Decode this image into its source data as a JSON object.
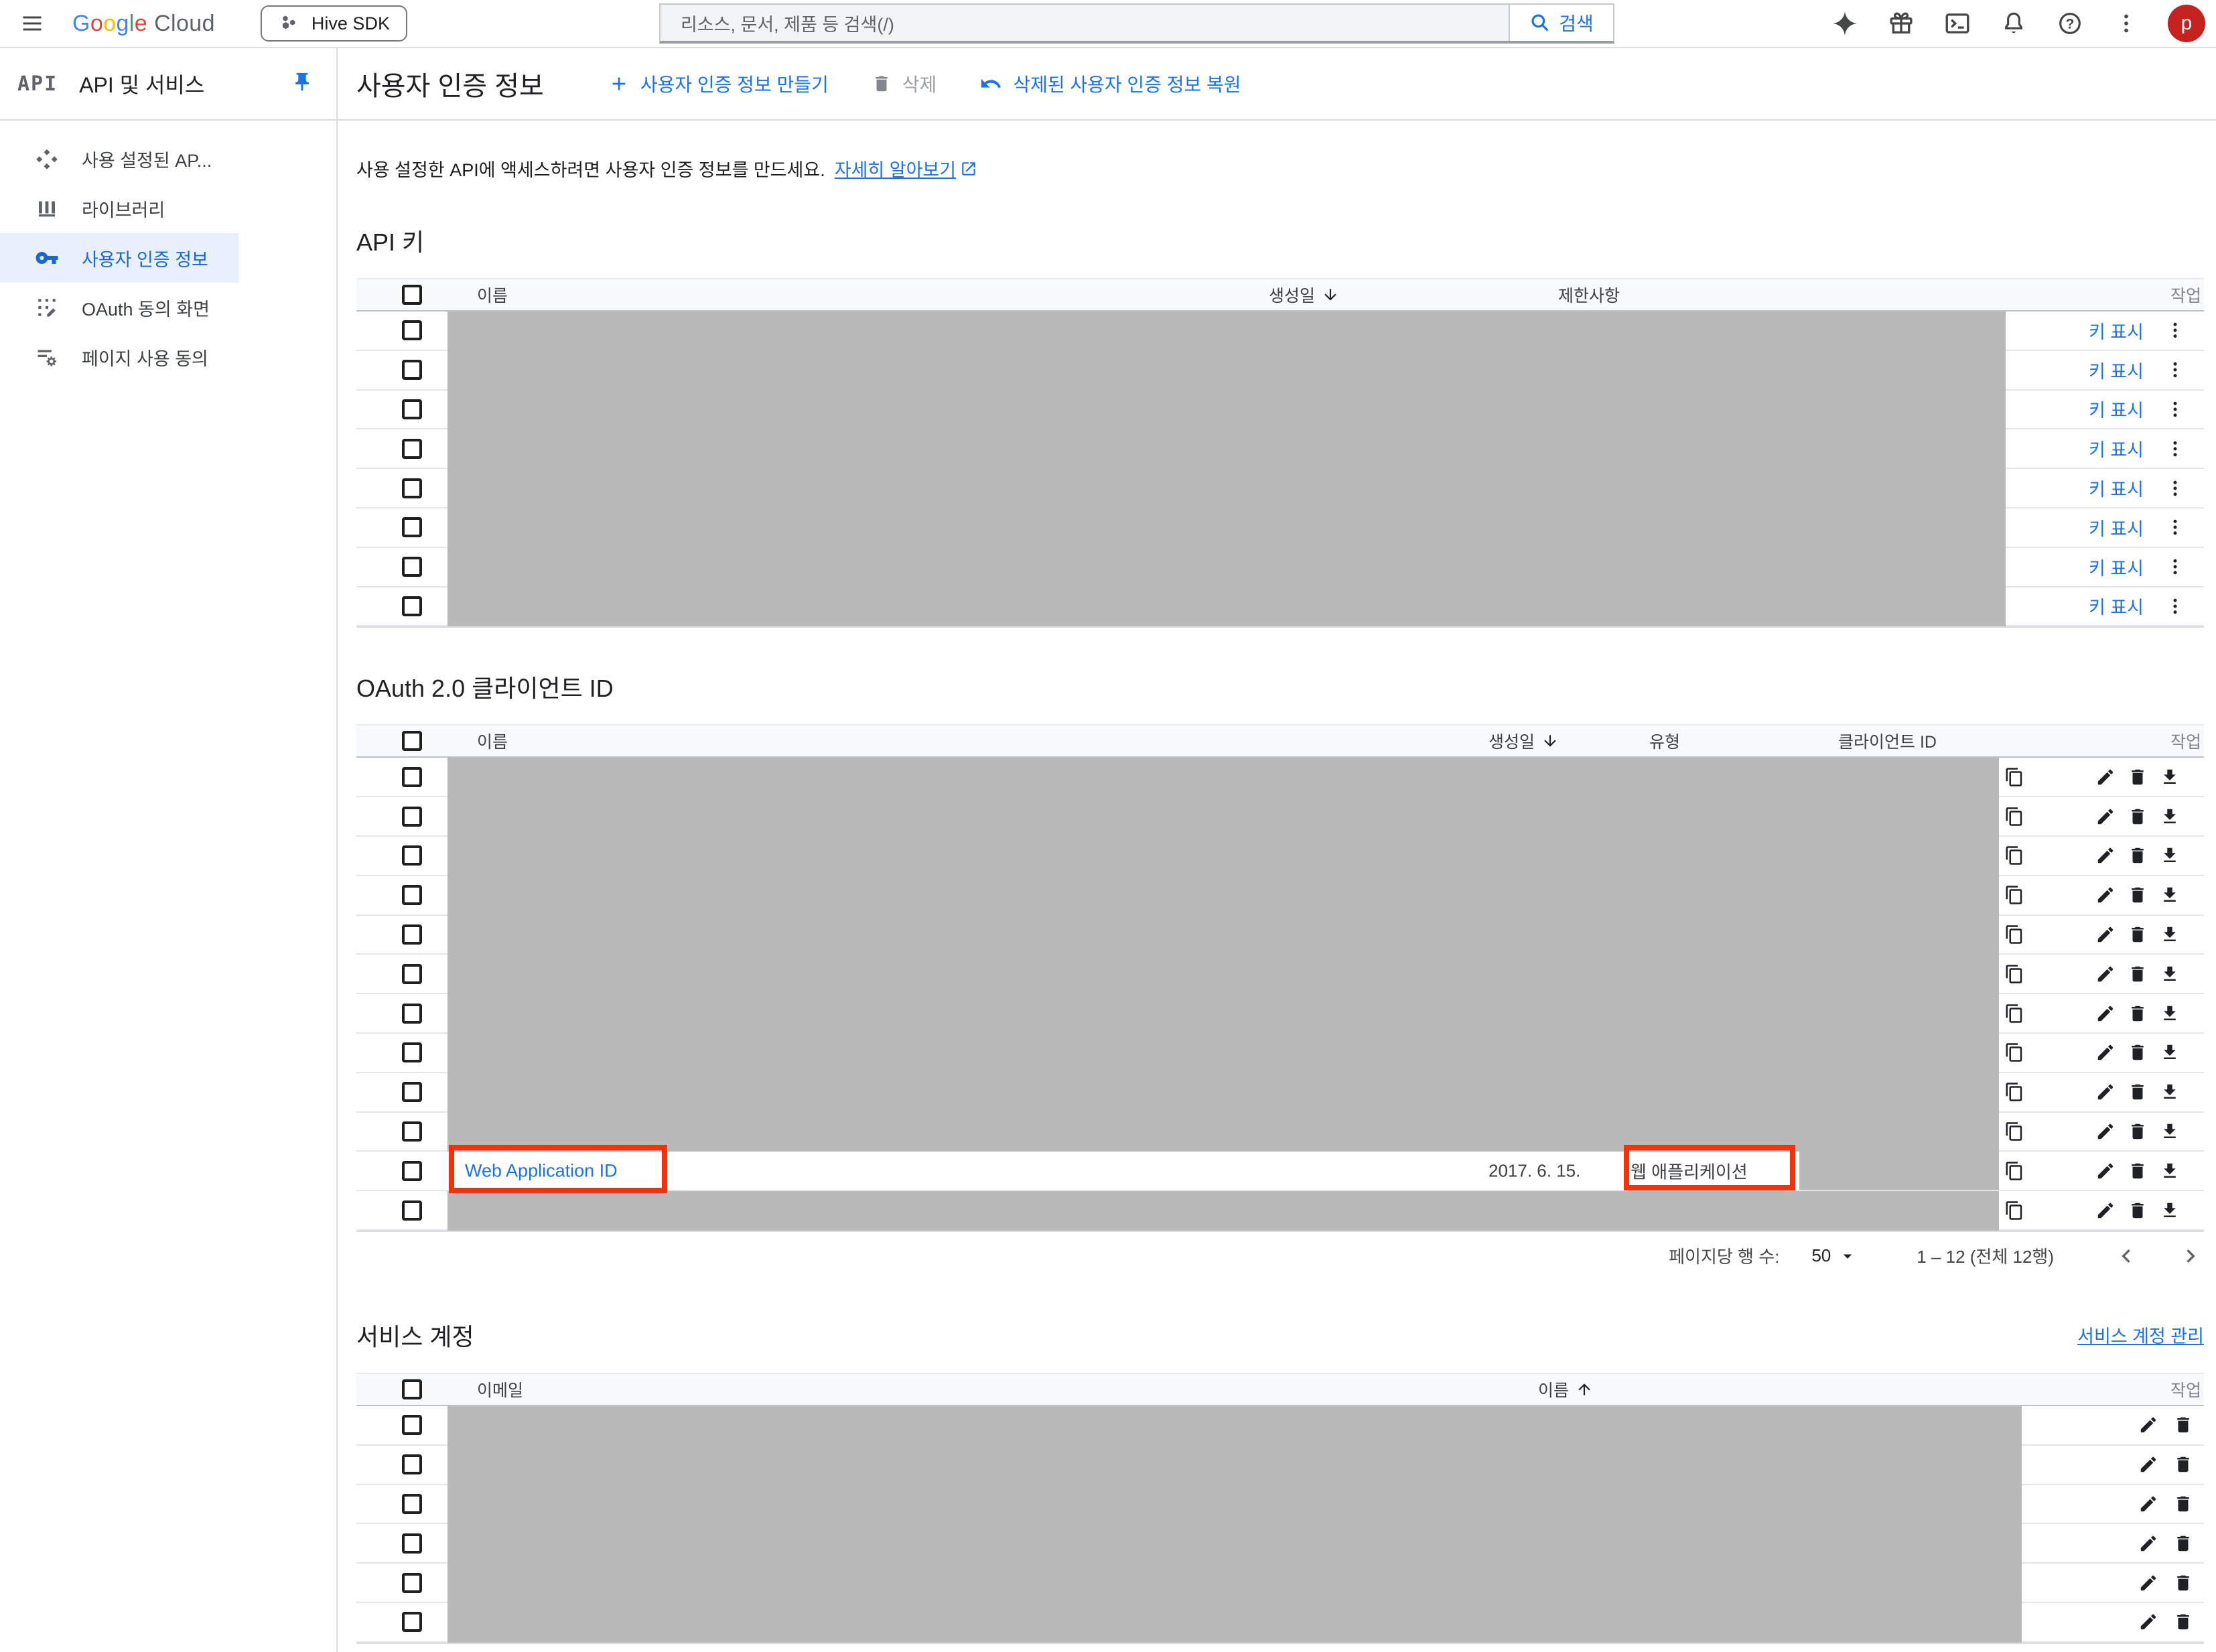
{
  "topbar": {
    "logo_google": "Google",
    "logo_cloud": "Cloud",
    "project": "Hive SDK",
    "search_placeholder": "리소스, 문서, 제품 등 검색(/)",
    "search_button": "검색",
    "avatar_letter": "p"
  },
  "sidebar": {
    "product_glyph": "API",
    "title": "API 및 서비스",
    "items": [
      {
        "id": "enabled-apis",
        "label": "사용 설정된 AP...",
        "selected": false
      },
      {
        "id": "library",
        "label": "라이브러리",
        "selected": false
      },
      {
        "id": "credentials",
        "label": "사용자 인증 정보",
        "selected": true
      },
      {
        "id": "oauth-consent",
        "label": "OAuth 동의 화면",
        "selected": false
      },
      {
        "id": "page-consent",
        "label": "페이지 사용 동의",
        "selected": false
      }
    ]
  },
  "page_header": {
    "title": "사용자 인증 정보",
    "create_button": "사용자 인증 정보 만들기",
    "delete_button": "삭제",
    "restore_button": "삭제된 사용자 인증 정보 복원"
  },
  "intro": {
    "text": "사용 설정한 API에 액세스하려면 사용자 인증 정보를 만드세요.",
    "link": "자세히 알아보기"
  },
  "api_keys": {
    "heading": "API 키",
    "columns": {
      "name": "이름",
      "created": "생성일",
      "restrictions": "제한사항",
      "actions": "작업"
    },
    "sort": "created-desc",
    "redacted_rows": 8,
    "row_link": "키 표시"
  },
  "oauth_clients": {
    "heading": "OAuth 2.0 클라이언트 ID",
    "columns": {
      "name": "이름",
      "created": "생성일",
      "type": "유형",
      "client_id": "클라이언트 ID",
      "actions": "작업"
    },
    "sort": "created-desc",
    "total_rows": 12,
    "visible_row_index": 10,
    "visible_row": {
      "name": "Web Application ID",
      "created": "2017. 6. 15.",
      "type": "웹 애플리케이션",
      "client_id_redacted": true,
      "annotated": true
    },
    "pagination": {
      "rows_per_page_label": "페이지당 행 수:",
      "rows_per_page": "50",
      "range_text": "1 – 12 (전체 12행)"
    }
  },
  "service_accounts": {
    "heading": "서비스 계정",
    "manage_link": "서비스 계정 관리",
    "columns": {
      "email": "이메일",
      "name": "이름",
      "actions": "작업"
    },
    "sort": "name-asc",
    "redacted_rows": 6
  },
  "colors": {
    "accent-blue": "#1a73e8",
    "selected-blue": "#1967d2",
    "selected-bg": "#e8f0fe",
    "redaction-gray": "#b9b9b9",
    "annotation-red": "#f3310d",
    "avatar-red": "#c5221f",
    "logo-letters": [
      "#4285f4",
      "#ea4335",
      "#fbbc05",
      "#4285f4",
      "#34a853",
      "#ea4335"
    ]
  }
}
